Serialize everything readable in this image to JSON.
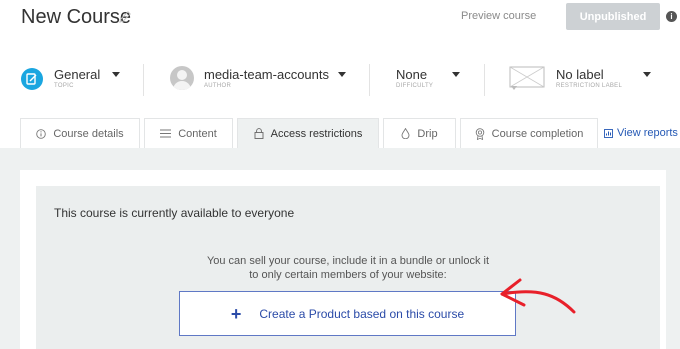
{
  "header": {
    "title": "New Course",
    "preview_label": "Preview course",
    "publish_label": "Unpublished",
    "info_glyph": "i"
  },
  "meta": {
    "topic": {
      "value": "General",
      "label": "TOPIC"
    },
    "author": {
      "value": "media-team-accounts",
      "label": "AUTHOR"
    },
    "difficulty": {
      "value": "None",
      "label": "DIFFICULTY"
    },
    "restriction": {
      "value": "No label",
      "label": "RESTRICTION LABEL"
    }
  },
  "tabs": [
    {
      "label": "Course details",
      "icon": "info-icon"
    },
    {
      "label": "Content",
      "icon": "list-icon"
    },
    {
      "label": "Access restrictions",
      "icon": "lock-icon",
      "active": true
    },
    {
      "label": "Drip",
      "icon": "drop-icon"
    },
    {
      "label": "Course completion",
      "icon": "award-icon"
    }
  ],
  "view_reports": "View reports",
  "access": {
    "availability": "This course is currently available to everyone",
    "sell_line1": "You can sell your course, include it in a bundle or unlock it",
    "sell_line2": "to only certain members of your website:",
    "create_label": "Create a Product based on this course",
    "create_glyph": "+"
  },
  "colors": {
    "accent_blue": "#2b4ba8",
    "topic_icon": "#1aa6e0",
    "annotation_red": "#e8202a",
    "panel_bg": "#eef1f1"
  }
}
